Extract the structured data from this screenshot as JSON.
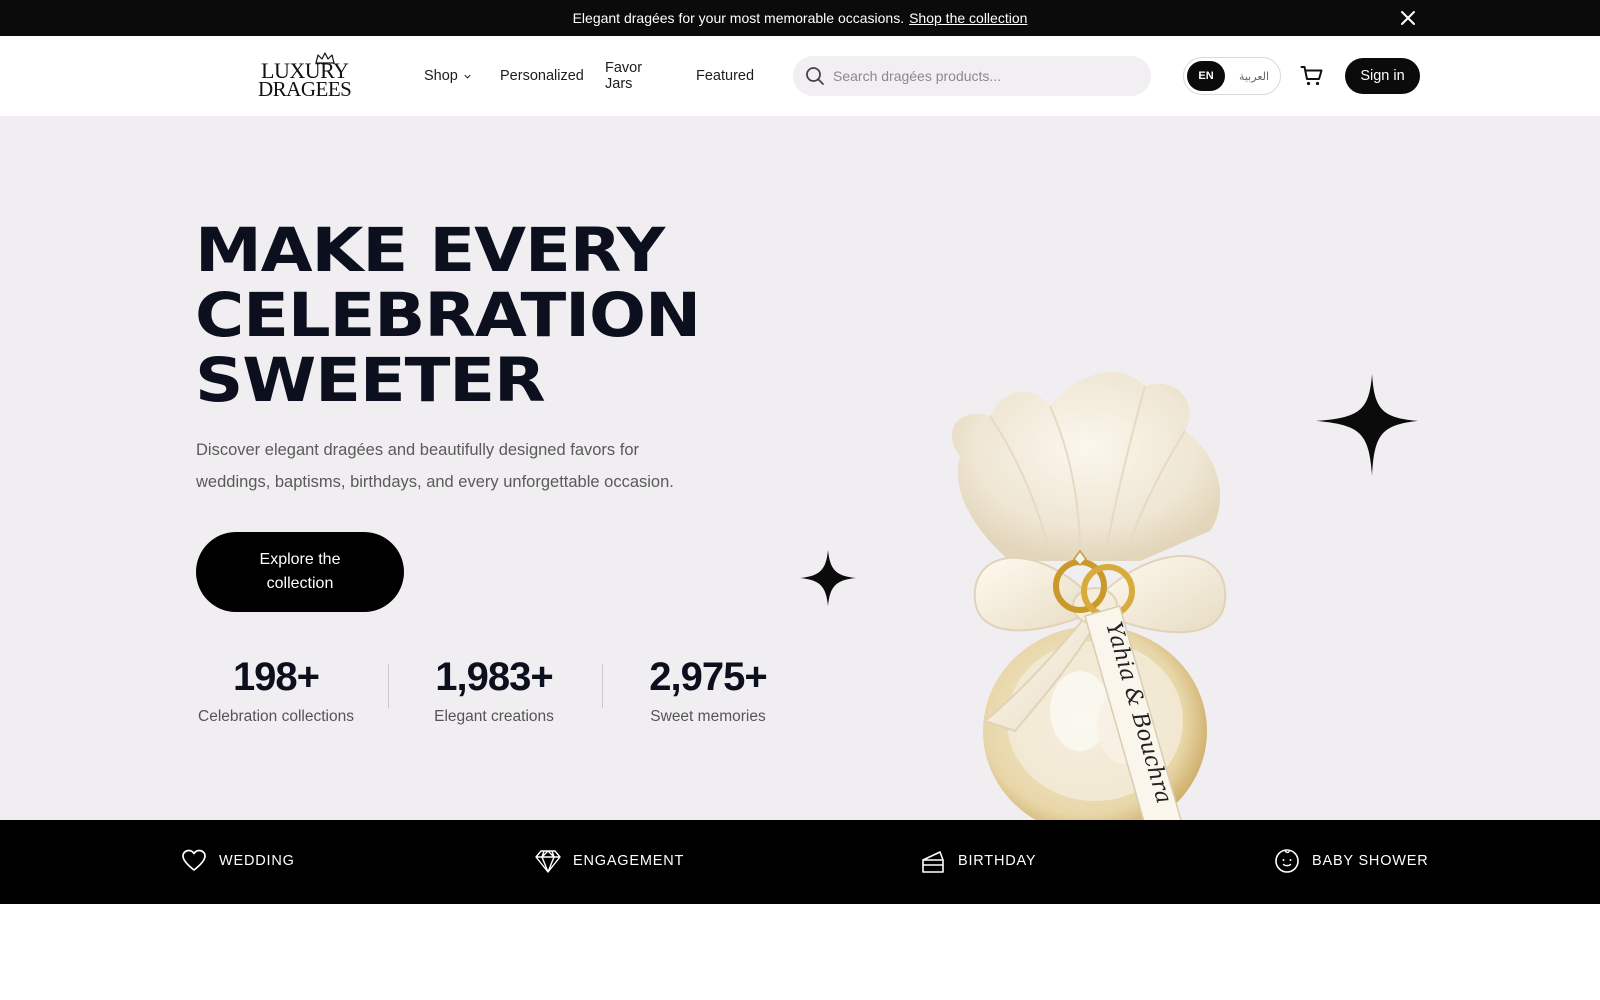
{
  "announcement": {
    "text": "Elegant dragées for your most memorable occasions.",
    "link": "Shop the collection"
  },
  "header": {
    "logo": {
      "line1": "LUXURY",
      "line2": "DRAGEES"
    },
    "nav": {
      "shop": "Shop",
      "personalized": "Personalized",
      "favor_jars": "Favor Jars",
      "featured": "Featured"
    },
    "search": {
      "placeholder": "Search dragées products...",
      "value": ""
    },
    "language": {
      "en": "EN",
      "ar": "العربية",
      "selected": "EN"
    },
    "sign_in": "Sign in"
  },
  "hero": {
    "headline": [
      "MAKE EVERY",
      "CELEBRATION",
      "SWEETER"
    ],
    "subtext": "Discover elegant dragées and beautifully designed favors for weddings, baptisms, birthdays, and every unforgettable occasion.",
    "cta": "Explore the collection",
    "stats": [
      {
        "value": "198+",
        "label": "Celebration collections"
      },
      {
        "value": "1,983+",
        "label": "Elegant creations"
      },
      {
        "value": "2,975+",
        "label": "Sweet memories"
      }
    ],
    "product_tag_text": "Yahia & Bouchra"
  },
  "categories": [
    {
      "label": "WEDDING",
      "icon": "heart-icon"
    },
    {
      "label": "ENGAGEMENT",
      "icon": "diamond-icon"
    },
    {
      "label": "BIRTHDAY",
      "icon": "cake-icon"
    },
    {
      "label": "BABY SHOWER",
      "icon": "baby-face-icon"
    }
  ],
  "colors": {
    "dark": "#0b0b0b",
    "hero_bg": "#f0eef0",
    "headline": "#0c0f1d",
    "search_bg": "#f1eff2"
  }
}
